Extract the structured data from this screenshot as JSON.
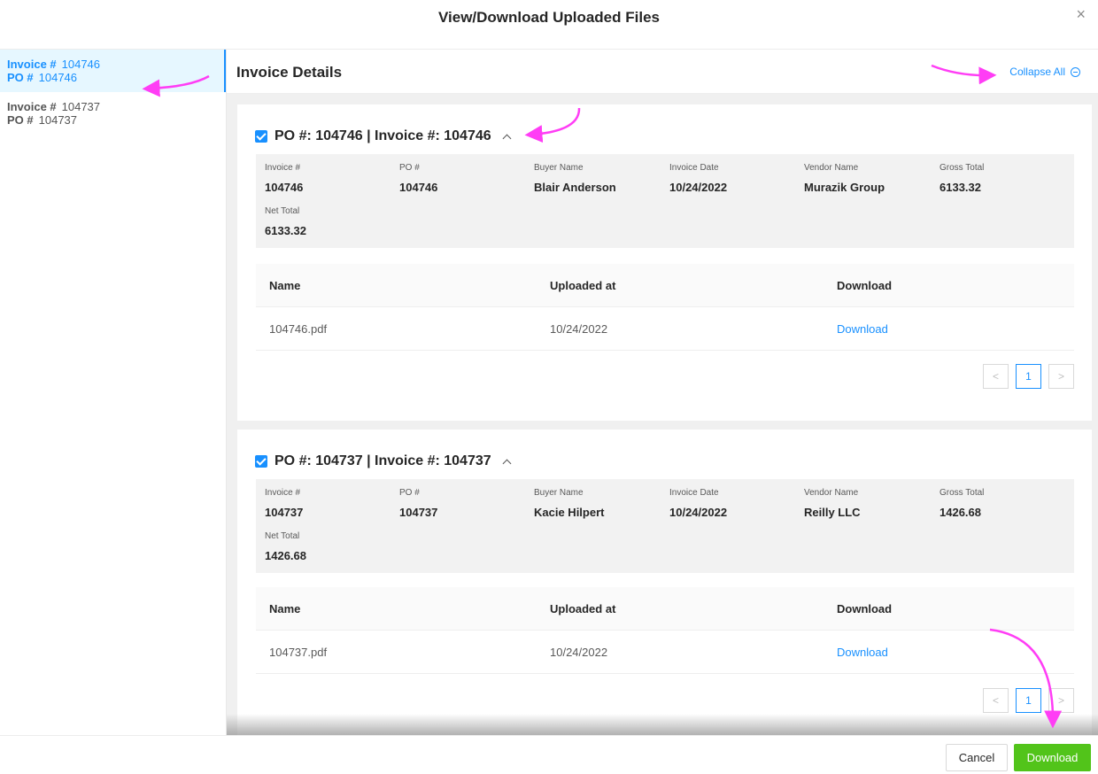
{
  "modal": {
    "title": "View/Download Uploaded Files",
    "close_glyph": "×"
  },
  "sidebar": {
    "items": [
      {
        "invoice_label": "Invoice #",
        "invoice_value": "104746",
        "po_label": "PO #",
        "po_value": "104746",
        "active": true
      },
      {
        "invoice_label": "Invoice #",
        "invoice_value": "104737",
        "po_label": "PO #",
        "po_value": "104737",
        "active": false
      }
    ]
  },
  "main": {
    "title": "Invoice Details",
    "collapse_all": "Collapse All"
  },
  "cards": [
    {
      "title": "PO #: 104746 | Invoice #: 104746",
      "fields": [
        {
          "label": "Invoice #",
          "value": "104746"
        },
        {
          "label": "PO #",
          "value": "104746"
        },
        {
          "label": "Buyer Name",
          "value": "Blair Anderson"
        },
        {
          "label": "Invoice Date",
          "value": "10/24/2022"
        },
        {
          "label": "Vendor Name",
          "value": "Murazik Group"
        },
        {
          "label": "Gross Total",
          "value": "6133.32"
        },
        {
          "label": "Net Total",
          "value": "6133.32"
        }
      ],
      "table": {
        "headers": [
          "Name",
          "Uploaded at",
          "Download"
        ],
        "rows": [
          {
            "name": "104746.pdf",
            "uploaded": "10/24/2022",
            "download": "Download"
          }
        ]
      },
      "pager": {
        "prev": "<",
        "current": "1",
        "next": ">"
      }
    },
    {
      "title": "PO #: 104737 | Invoice #: 104737",
      "fields": [
        {
          "label": "Invoice #",
          "value": "104737"
        },
        {
          "label": "PO #",
          "value": "104737"
        },
        {
          "label": "Buyer Name",
          "value": "Kacie Hilpert"
        },
        {
          "label": "Invoice Date",
          "value": "10/24/2022"
        },
        {
          "label": "Vendor Name",
          "value": "Reilly LLC"
        },
        {
          "label": "Gross Total",
          "value": "1426.68"
        },
        {
          "label": "Net Total",
          "value": "1426.68"
        }
      ],
      "table": {
        "headers": [
          "Name",
          "Uploaded at",
          "Download"
        ],
        "rows": [
          {
            "name": "104737.pdf",
            "uploaded": "10/24/2022",
            "download": "Download"
          }
        ]
      },
      "pager": {
        "prev": "<",
        "current": "1",
        "next": ">"
      }
    }
  ],
  "footer": {
    "cancel_label": "Cancel",
    "download_label": "Download"
  },
  "colors": {
    "accent": "#1890ff",
    "success": "#52c41a",
    "annotation": "#ff3df5"
  },
  "icons": {
    "close": "close-icon",
    "checkbox": "checkbox-checked-icon",
    "chevron": "chevron-up-icon",
    "collapse": "minus-circle-icon"
  }
}
